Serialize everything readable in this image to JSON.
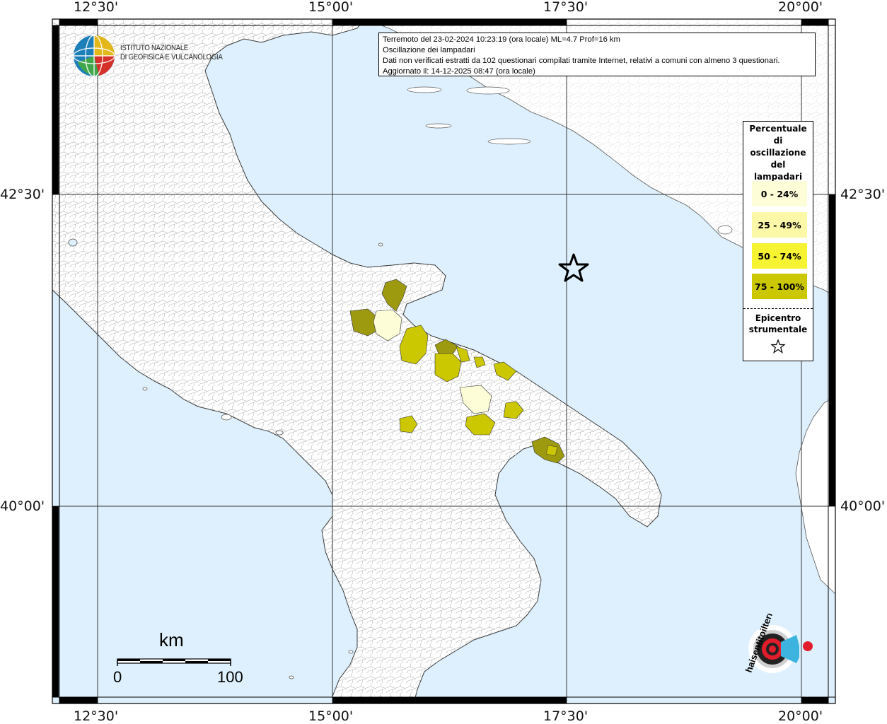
{
  "info": {
    "line1": "Terremoto del 23-02-2024 10:23:19 (ora locale) ML=4.7 Prof=16 km",
    "line2": "Oscillazione dei lampadari",
    "line3": "Dati non verificati estratti da 102 questionari compilati tramite Internet, relativi a comuni con almeno 3 questionari.",
    "line4": "Aggiornato il: 14-12-2025 08:47 (ora locale)"
  },
  "axes": {
    "top": [
      "12°30'",
      "15°00'",
      "17°30'",
      "20°00'"
    ],
    "bottom": [
      "12°30'",
      "15°00'",
      "17°30'",
      "20°00'"
    ],
    "left": [
      "42°30'",
      "40°00'"
    ],
    "right": [
      "42°30'",
      "40°00'"
    ]
  },
  "legend": {
    "title_lines": [
      "Percentuale",
      "di",
      "oscillazione",
      "del",
      "lampadari"
    ],
    "classes": [
      {
        "label": "0 - 24%",
        "color": "#fdfdd8"
      },
      {
        "label": "25 - 49%",
        "color": "#fbf8a8"
      },
      {
        "label": "50 - 74%",
        "color": "#f6f332"
      },
      {
        "label": "75 - 100%",
        "color": "#cbc700"
      }
    ],
    "epicenter_lines": [
      "Epicentro",
      "strumentale"
    ]
  },
  "institute": {
    "line1": "ISTITUTO NAZIONALE",
    "line2": "DI GEOFISICA E VULCANOLOGIA"
  },
  "scale": {
    "unit": "km",
    "zero": "0",
    "max": "100"
  },
  "logo_text": "haisentitoilterremoto.it",
  "colors": {
    "sea": "#def0fd",
    "land": "#ffffff",
    "c0": "#fdfdd8",
    "c1": "#fbf8a8",
    "c2": "#f6f332",
    "c3": "#cbc700",
    "c4": "#9e9a10"
  }
}
